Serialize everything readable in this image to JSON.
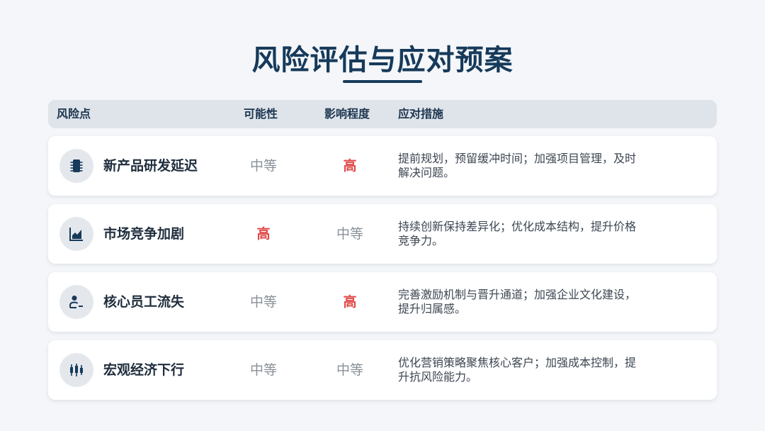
{
  "title": "风险评估与应对预案",
  "header": {
    "risk": "风险点",
    "probability": "可能性",
    "impact": "影响程度",
    "measures": "应对措施"
  },
  "rows": [
    {
      "icon": "chip-icon",
      "name": "新产品研发延迟",
      "probability": "中等",
      "impact": "高",
      "measures": "提前规划，预留缓冲时间；加强项目管理，及时解决问题。"
    },
    {
      "icon": "area-chart-icon",
      "name": "市场竞争加剧",
      "probability": "高",
      "impact": "中等",
      "measures": "持续创新保持差异化；优化成本结构，提升价格竞争力。"
    },
    {
      "icon": "user-minus-icon",
      "name": "核心员工流失",
      "probability": "中等",
      "impact": "高",
      "measures": "完善激励机制与晋升通道；加强企业文化建设，提升归属感。"
    },
    {
      "icon": "candlestick-icon",
      "name": "宏观经济下行",
      "probability": "中等",
      "impact": "中等",
      "measures": "优化营销策略聚焦核心客户；加强成本控制，提升抗风险能力。"
    }
  ],
  "colors": {
    "title": "#163a5a",
    "high": "#e04848",
    "medium": "#8a9099",
    "header_bg": "#dfe4ea"
  }
}
